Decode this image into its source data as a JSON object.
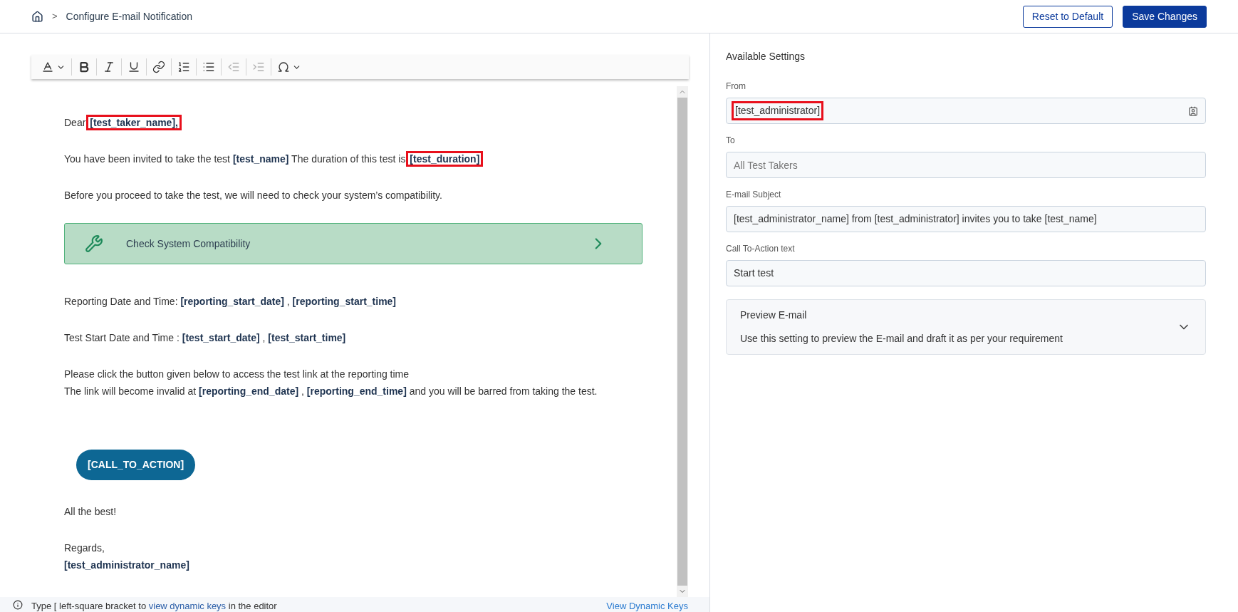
{
  "breadcrumb": {
    "separator": ">",
    "current": "Configure E-mail Notification"
  },
  "actions": [
    {
      "label": "Reset to Default",
      "kind": "secondary"
    },
    {
      "label": "Save Changes",
      "kind": "primary"
    }
  ],
  "toolbar": [
    {
      "kind": "font-color",
      "disabled": false
    },
    {
      "kind": "bold",
      "disabled": false
    },
    {
      "kind": "italic",
      "disabled": false
    },
    {
      "kind": "underline",
      "disabled": false
    },
    {
      "kind": "link",
      "disabled": false
    },
    {
      "kind": "numbered-list",
      "disabled": false
    },
    {
      "kind": "bullet-list",
      "disabled": false
    },
    {
      "kind": "outdent",
      "disabled": true
    },
    {
      "kind": "indent",
      "disabled": true
    },
    {
      "kind": "special-chars",
      "disabled": false
    }
  ],
  "email": {
    "blocks": [
      {
        "kind": "paragraph",
        "segments": [
          {
            "kind": "text",
            "text": "Dear "
          },
          {
            "kind": "key",
            "text": "[test_taker_name],",
            "highlighted": true
          }
        ]
      },
      {
        "kind": "paragraph",
        "segments": [
          {
            "kind": "text",
            "text": "You have been invited to take the test "
          },
          {
            "kind": "key",
            "text": "[test_name]",
            "highlighted": false
          },
          {
            "kind": "text",
            "text": " The duration of this test is "
          },
          {
            "kind": "key",
            "text": "[test_duration]",
            "highlighted": true
          }
        ]
      },
      {
        "kind": "paragraph",
        "segments": [
          {
            "kind": "text",
            "text": "Before you proceed to take the test, we will need to check your system’s compatibility."
          }
        ]
      },
      {
        "kind": "banner",
        "label": "Check System Compatibility"
      },
      {
        "kind": "paragraph",
        "text": "Reporting Date and Time: **[reporting_start_date]** , **[reporting_start_time]**"
      },
      {
        "kind": "paragraph",
        "text": "Test Start Date and Time : **[test_start_date]** , **[test_start_time]**"
      },
      {
        "kind": "line",
        "segments": [
          {
            "kind": "text",
            "text": "Please click the button given below to access the test link at the reporting time"
          }
        ]
      },
      {
        "kind": "paragraph",
        "text": "The link will become invalid at **[reporting_end_date]** , **[reporting_end_time]** and you will be barred from taking the test."
      },
      {
        "kind": "cta",
        "label": "[CALL_TO_ACTION]"
      },
      {
        "kind": "paragraph",
        "segments": [
          {
            "kind": "text",
            "text": "All the best!"
          }
        ]
      },
      {
        "kind": "line",
        "segments": [
          {
            "kind": "text",
            "text": "Regards,"
          }
        ]
      },
      {
        "kind": "line",
        "text": "**[test_administrator_name]**"
      }
    ]
  },
  "hint": {
    "before": "Type [ left-square bracket to ",
    "link": "view dynamic keys",
    "after": " in the editor",
    "action": "View Dynamic Keys"
  },
  "settings": {
    "title": "Available Settings",
    "fields": [
      {
        "label": "From",
        "value": "[test_administrator]",
        "highlighted": true,
        "kind": "picker"
      },
      {
        "label": "To",
        "placeholder": "All Test Takers",
        "kind": "text"
      },
      {
        "label": "E-mail Subject",
        "value": "[test_administrator_name] from [test_administrator] invites you to take [test_name]",
        "highlighted": false,
        "kind": "text"
      },
      {
        "label": "Call To-Action text",
        "value": "Start test",
        "highlighted": false,
        "kind": "text"
      }
    ],
    "preview": {
      "title": "Preview E-mail",
      "description": "Use this setting to preview the E-mail and draft it as per your requirement",
      "expanded": false
    }
  }
}
